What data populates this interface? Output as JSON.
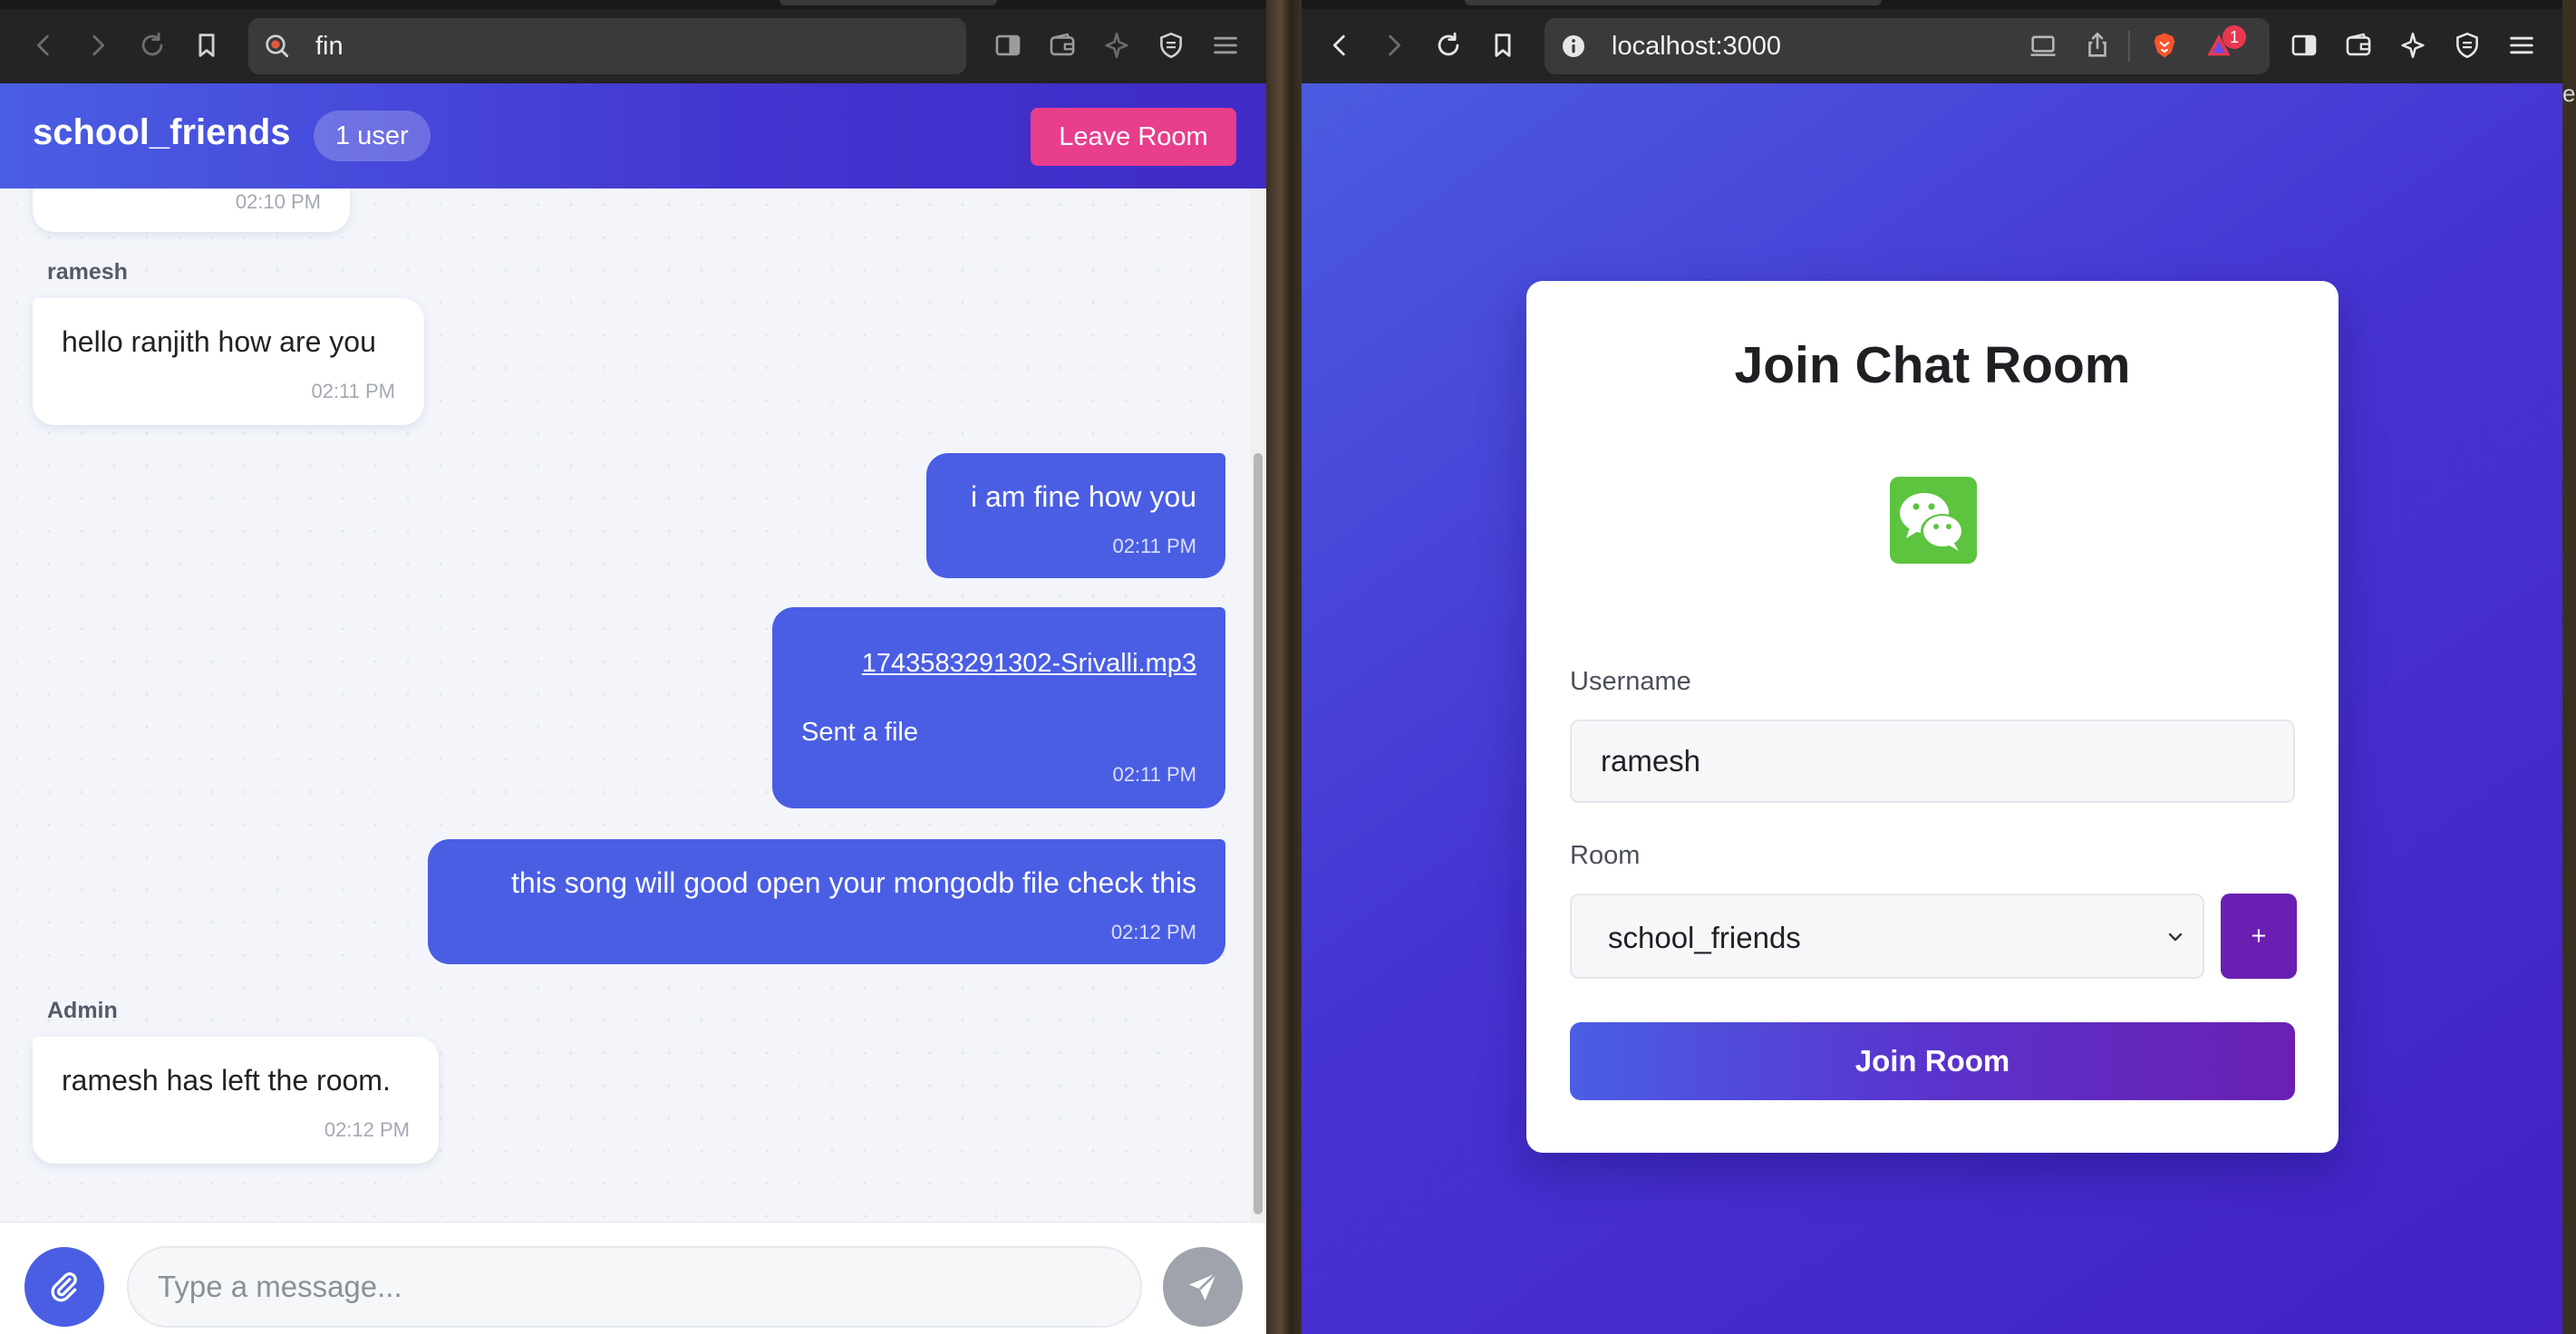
{
  "left_browser": {
    "address_text": "fin",
    "icons": [
      "back-icon",
      "forward-icon",
      "reload-icon",
      "bookmark-icon",
      "sidebar-icon",
      "wallet-icon",
      "leo-icon",
      "shield-icon",
      "menu-icon"
    ]
  },
  "chat": {
    "room_name": "school_friends",
    "user_count": "1 user",
    "leave_button": "Leave Room",
    "partial_time": "02:10 PM",
    "messages": [
      {
        "sender": "ramesh",
        "text": "hello ranjith how are you",
        "time": "02:11 PM",
        "direction": "in"
      },
      {
        "text": "i am fine how you",
        "time": "02:11 PM",
        "direction": "out"
      },
      {
        "file": "1743583291302-Srivalli.mp3",
        "text": "Sent a file",
        "time": "02:11 PM",
        "direction": "out"
      },
      {
        "text": "this song will good open your mongodb file check this",
        "time": "02:12 PM",
        "direction": "out"
      },
      {
        "sender": "Admin",
        "text": "ramesh has left the room.",
        "time": "02:12 PM",
        "direction": "in"
      }
    ],
    "composer_placeholder": "Type a message...",
    "colors": {
      "primary": "#4a5ee4",
      "leave": "#e83e8c",
      "background": "#f3f5fb"
    }
  },
  "right_browser": {
    "address_text": "localhost:3000",
    "notification_count": "1",
    "icons": [
      "back-icon",
      "forward-icon",
      "reload-icon",
      "bookmark-icon",
      "info-icon",
      "cast-icon",
      "share-icon",
      "brave-icon",
      "rewards-icon",
      "sidebar-icon",
      "wallet-icon",
      "leo-icon",
      "shield-icon",
      "menu-icon"
    ]
  },
  "join_form": {
    "title": "Join Chat Room",
    "logo": "wechat-logo",
    "username_label": "Username",
    "username_value": "ramesh",
    "room_label": "Room",
    "room_selected": "school_friends",
    "add_room_label": "+",
    "join_button": "Join Room",
    "colors": {
      "gradient_start": "#4a5ee4",
      "gradient_end": "#6a1fb2",
      "logo_green": "#5cc43f"
    }
  },
  "edge_text": "e"
}
